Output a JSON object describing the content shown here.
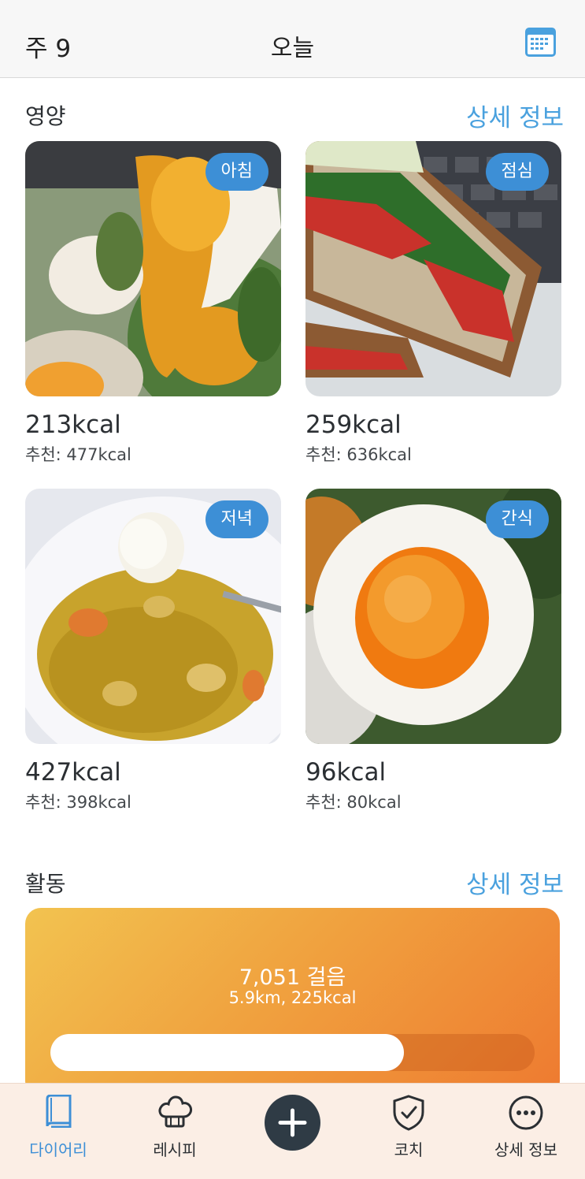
{
  "header": {
    "week": "주 9",
    "title": "오늘",
    "calendar_icon": "calendar-icon"
  },
  "nutrition": {
    "title": "영양",
    "more": "상세 정보",
    "meals": [
      {
        "badge": "아침",
        "kcal": "213kcal",
        "rec": "추천: 477kcal"
      },
      {
        "badge": "점심",
        "kcal": "259kcal",
        "rec": "추천: 636kcal"
      },
      {
        "badge": "저녁",
        "kcal": "427kcal",
        "rec": "추천: 398kcal"
      },
      {
        "badge": "간식",
        "kcal": "96kcal",
        "rec": "추천: 80kcal"
      }
    ]
  },
  "activity": {
    "title": "활동",
    "more": "상세 정보",
    "steps": "7,051 걸음",
    "detail": "5.9km, 225kcal",
    "progress": 0.73
  },
  "tabs": [
    {
      "label": "다이어리",
      "icon": "book-icon",
      "active": true
    },
    {
      "label": "레시피",
      "icon": "chef-hat-icon",
      "active": false
    },
    {
      "label": "",
      "icon": "plus-icon",
      "active": false
    },
    {
      "label": "코치",
      "icon": "shield-check-icon",
      "active": false
    },
    {
      "label": "상세 정보",
      "icon": "more-icon",
      "active": false
    }
  ],
  "colors": {
    "accent": "#3d8fd6",
    "link": "#4aa1de",
    "badge": "#3d8fd6",
    "activity_start": "#f2c350",
    "activity_end": "#ee7a30"
  }
}
